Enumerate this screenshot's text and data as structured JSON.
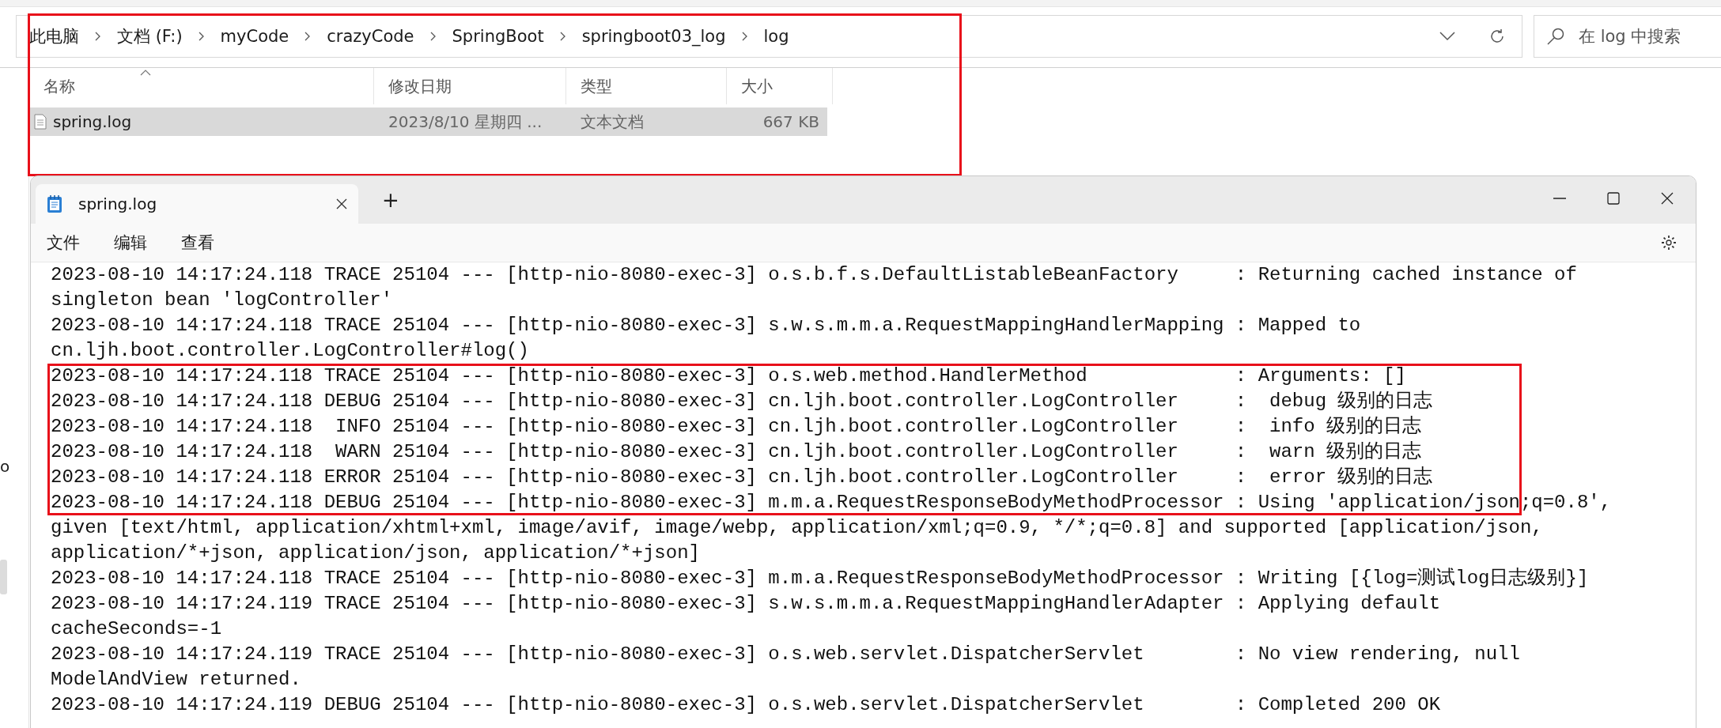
{
  "explorer": {
    "highlighted": true,
    "breadcrumbs": [
      "此电脑",
      "文档 (F:)",
      "myCode",
      "crazyCode",
      "SpringBoot",
      "springboot03_log",
      "log"
    ],
    "search": {
      "placeholder": "在 log 中搜索"
    },
    "columns": [
      {
        "label": "名称",
        "sorted": true
      },
      {
        "label": "修改日期",
        "sorted": false
      },
      {
        "label": "类型",
        "sorted": false
      },
      {
        "label": "大小",
        "sorted": false
      }
    ],
    "rows": [
      {
        "name": "spring.log",
        "modified": "2023/8/10  星期四 ...",
        "type": "文本文档",
        "size": "667 KB",
        "selected": true
      }
    ],
    "sidebar_fragment": "o"
  },
  "notepad": {
    "tabs": [
      {
        "title": "spring.log",
        "selected": true
      }
    ],
    "new_tab": "+",
    "menu": [
      "文件",
      "编辑",
      "查看"
    ],
    "log_blocks": [
      {
        "highlighted": false,
        "lines": [
          "2023-08-10 14:17:24.118 TRACE 25104 --- [http-nio-8080-exec-3] o.s.b.f.s.DefaultListableBeanFactory     : Returning cached instance of",
          "singleton bean 'logController'",
          "2023-08-10 14:17:24.118 TRACE 25104 --- [http-nio-8080-exec-3] s.w.s.m.m.a.RequestMappingHandlerMapping : Mapped to",
          "cn.ljh.boot.controller.LogController#log()"
        ]
      },
      {
        "highlighted": true,
        "lines": [
          "2023-08-10 14:17:24.118 TRACE 25104 --- [http-nio-8080-exec-3] o.s.web.method.HandlerMethod             : Arguments: []",
          "2023-08-10 14:17:24.118 DEBUG 25104 --- [http-nio-8080-exec-3] cn.ljh.boot.controller.LogController     :  debug 级别的日志",
          "2023-08-10 14:17:24.118  INFO 25104 --- [http-nio-8080-exec-3] cn.ljh.boot.controller.LogController     :  info 级别的日志",
          "2023-08-10 14:17:24.118  WARN 25104 --- [http-nio-8080-exec-3] cn.ljh.boot.controller.LogController     :  warn 级别的日志",
          "2023-08-10 14:17:24.118 ERROR 25104 --- [http-nio-8080-exec-3] cn.ljh.boot.controller.LogController     :  error 级别的日志",
          "2023-08-10 14:17:24.118 DEBUG 25104 --- [http-nio-8080-exec-3] m.m.a.RequestResponseBodyMethodProcessor : Using 'application/json;q=0.8',"
        ]
      },
      {
        "highlighted": false,
        "lines": [
          "given [text/html, application/xhtml+xml, image/avif, image/webp, application/xml;q=0.9, */*;q=0.8] and supported [application/json,",
          "application/*+json, application/json, application/*+json]",
          "2023-08-10 14:17:24.118 TRACE 25104 --- [http-nio-8080-exec-3] m.m.a.RequestResponseBodyMethodProcessor : Writing [{log=测试log日志级别}]",
          "2023-08-10 14:17:24.119 TRACE 25104 --- [http-nio-8080-exec-3] s.w.s.m.m.a.RequestMappingHandlerAdapter : Applying default",
          "cacheSeconds=-1",
          "2023-08-10 14:17:24.119 TRACE 25104 --- [http-nio-8080-exec-3] o.s.web.servlet.DispatcherServlet        : No view rendering, null",
          "ModelAndView returned.",
          "2023-08-10 14:17:24.119 DEBUG 25104 --- [http-nio-8080-exec-3] o.s.web.servlet.DispatcherServlet        : Completed 200 OK"
        ]
      }
    ]
  }
}
